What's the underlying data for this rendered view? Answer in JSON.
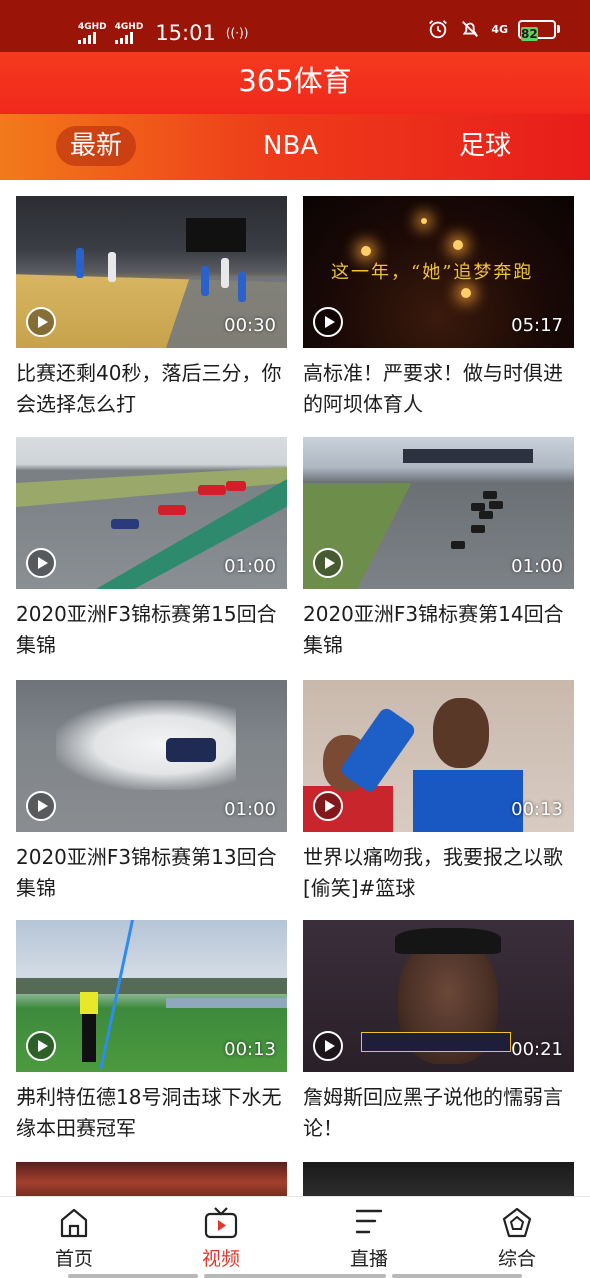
{
  "status_bar": {
    "time": "15:01",
    "signal1": "4GHD",
    "signal2": "4GHD",
    "network": "4G",
    "battery": "82"
  },
  "header": {
    "title": "365体育"
  },
  "tabs": [
    {
      "label": "最新",
      "active": true
    },
    {
      "label": "NBA",
      "active": false
    },
    {
      "label": "足球",
      "active": false
    }
  ],
  "videos": [
    {
      "title": "比赛还剩40秒，落后三分，你会选择怎么打",
      "duration": "00:30"
    },
    {
      "title": "高标准！严要求！做与时俱进的阿坝体育人",
      "duration": "05:17",
      "overlay_text": "这一年，“她”追梦奔跑"
    },
    {
      "title": "2020亚洲F3锦标赛第15回合集锦",
      "duration": "01:00"
    },
    {
      "title": "2020亚洲F3锦标赛第14回合集锦",
      "duration": "01:00"
    },
    {
      "title": "2020亚洲F3锦标赛第13回合集锦",
      "duration": "01:00"
    },
    {
      "title": "世界以痛吻我，我要报之以歌[偷笑]#篮球",
      "duration": "00:13"
    },
    {
      "title": "弗利特伍德18号洞击球下水无缘本田赛冠军",
      "duration": "00:13"
    },
    {
      "title": "詹姆斯回应黑子说他的懦弱言论！",
      "duration": "00:21"
    }
  ],
  "bottom_nav": [
    {
      "label": "首页",
      "icon": "home-icon",
      "active": false
    },
    {
      "label": "视频",
      "icon": "video-icon",
      "active": true
    },
    {
      "label": "直播",
      "icon": "live-icon",
      "active": false
    },
    {
      "label": "综合",
      "icon": "general-icon",
      "active": false
    }
  ],
  "colors": {
    "status_bar": "#9a1508",
    "header": "#f0281c",
    "tab_gradient_start": "#f27a1a",
    "tab_gradient_end": "#e81d1b",
    "active_nav": "#e2392c"
  }
}
